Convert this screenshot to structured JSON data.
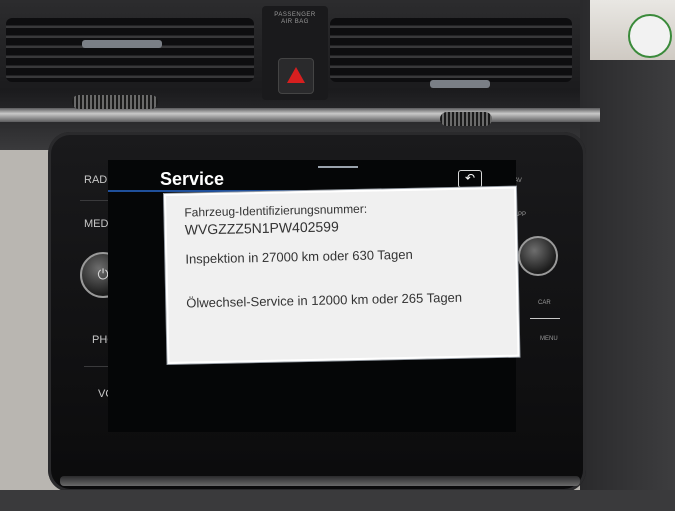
{
  "dashboard": {
    "airbag_label_line1": "PASSENGER",
    "airbag_label_line2": "AIR BAG"
  },
  "screen": {
    "title": "Service",
    "back_icon": "back-arrow-icon"
  },
  "dialog": {
    "line1": "Fahrzeug-Identifizierungsnummer:",
    "line2": "WVGZZZ5N1PW402599",
    "line3": "Inspektion in 27000 km oder 630 Tagen",
    "line4": "Ölwechsel-Service in 12000 km oder 265 Tagen"
  },
  "left_buttons": [
    "RADIO",
    "MEDIA",
    "PHONE",
    "VOICE"
  ],
  "right_buttons": [
    "NAV",
    "APP",
    "CAR",
    "MENU"
  ],
  "colors": {
    "accent_line": "#1f4f9a",
    "hazard": "#d61f1f",
    "dialog_bg": "#f0f0f0"
  }
}
